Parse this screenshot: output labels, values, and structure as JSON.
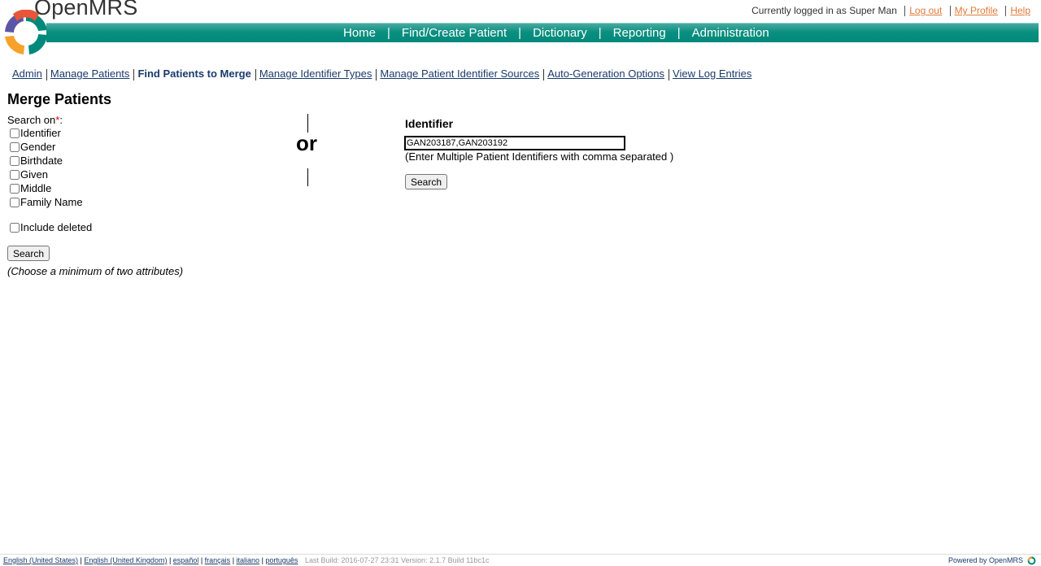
{
  "header": {
    "logo_text": "OpenMRS",
    "logged_in_text": "Currently logged in as Super Man",
    "logout": "Log out",
    "my_profile": "My Profile",
    "help": "Help"
  },
  "nav": {
    "items": [
      "Home",
      "Find/Create Patient",
      "Dictionary",
      "Reporting",
      "Administration"
    ],
    "separator": "|"
  },
  "submenu": {
    "items": [
      "Admin",
      "Manage Patients",
      "Find Patients to Merge",
      "Manage Identifier Types",
      "Manage Patient Identifier Sources",
      "Auto-Generation Options",
      "View Log Entries"
    ],
    "current": "Find Patients to Merge"
  },
  "page": {
    "title": "Merge Patients",
    "search_on_label": "Search on",
    "required_mark": "*",
    "colon": ":",
    "attributes": [
      "Identifier",
      "Gender",
      "Birthdate",
      "Given",
      "Middle",
      "Family Name"
    ],
    "include_deleted": "Include deleted",
    "search_button": "Search",
    "hint": "(Choose a minimum of two attributes)",
    "or": "or",
    "identifier": {
      "label": "Identifier",
      "value": "GAN203187,GAN203192",
      "note": "(Enter Multiple Patient Identifiers with comma separated )",
      "search_button": "Search"
    }
  },
  "footer": {
    "languages": [
      "English (United States)",
      "English (United Kingdom)",
      "español",
      "français",
      "italiano",
      "português"
    ],
    "build": "Last Build: 2016-07-27 23:31    Version: 2.1.7 Build 11bc1c",
    "powered": "Powered by OpenMRS"
  },
  "colors": {
    "nav_band": "#00897b",
    "link": "#1a3a6b",
    "user_link": "#e07a3a",
    "required": "#e00000"
  }
}
